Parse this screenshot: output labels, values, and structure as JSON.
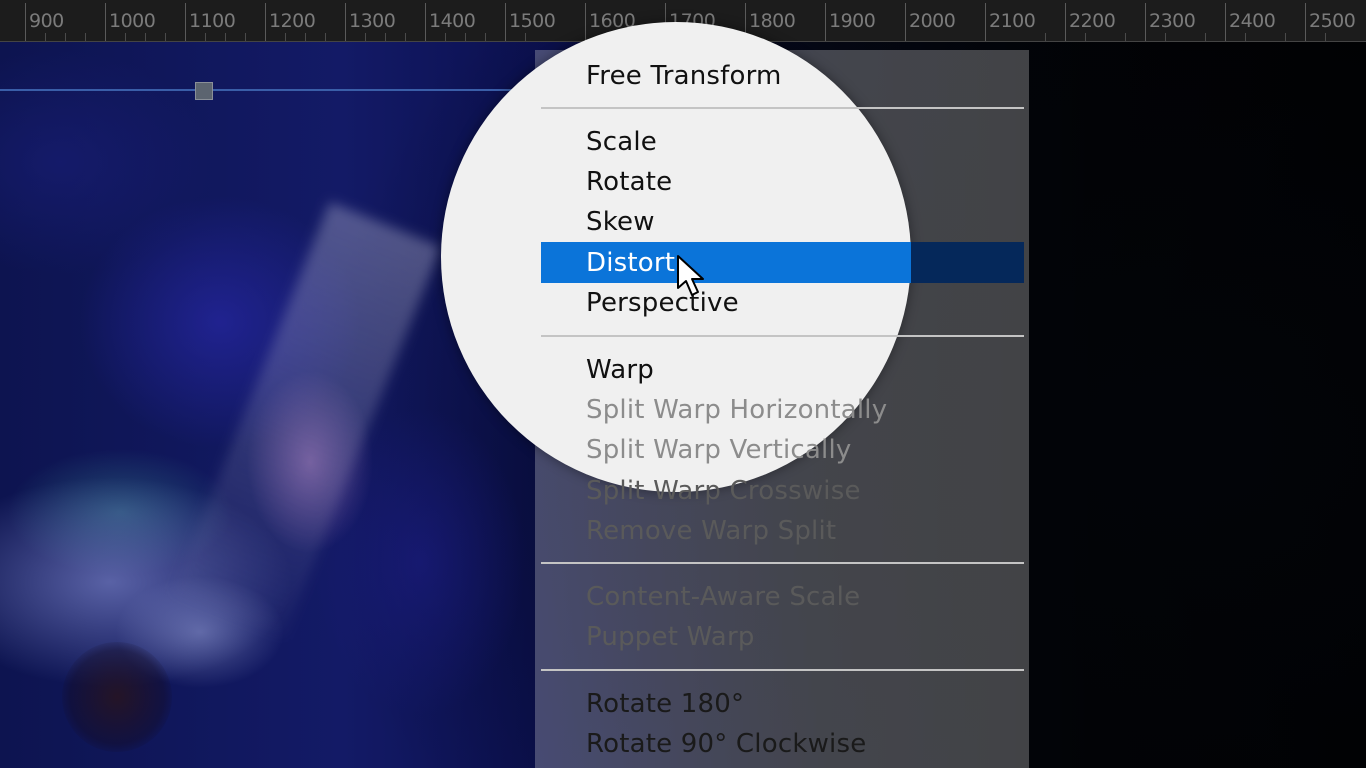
{
  "ruler": {
    "labels": [
      "900",
      "1000",
      "1100",
      "1200",
      "1300",
      "1400",
      "1500",
      "1600",
      "1700",
      "1800",
      "1900",
      "2000",
      "2100",
      "2200",
      "2300",
      "2400",
      "2500"
    ]
  },
  "menu": {
    "free_transform": "Free Transform",
    "scale": "Scale",
    "rotate": "Rotate",
    "skew": "Skew",
    "distort": "Distort",
    "perspective": "Perspective",
    "warp": "Warp",
    "split_warp_horizontally": "Split Warp Horizontally",
    "split_warp_vertically": "Split Warp Vertically",
    "split_warp_crosswise": "Split Warp Crosswise",
    "remove_warp_split": "Remove Warp Split",
    "content_aware_scale": "Content-Aware Scale",
    "puppet_warp": "Puppet Warp",
    "rotate_180": "Rotate 180°",
    "rotate_90_cw": "Rotate 90° Clockwise",
    "selected_item": "Distort"
  },
  "colors": {
    "highlight": "#0b74d9",
    "ruler_bg": "#1c1c1c",
    "menu_bg": "#f0f0f0"
  },
  "icons": [
    "mouse-pointer-icon"
  ]
}
